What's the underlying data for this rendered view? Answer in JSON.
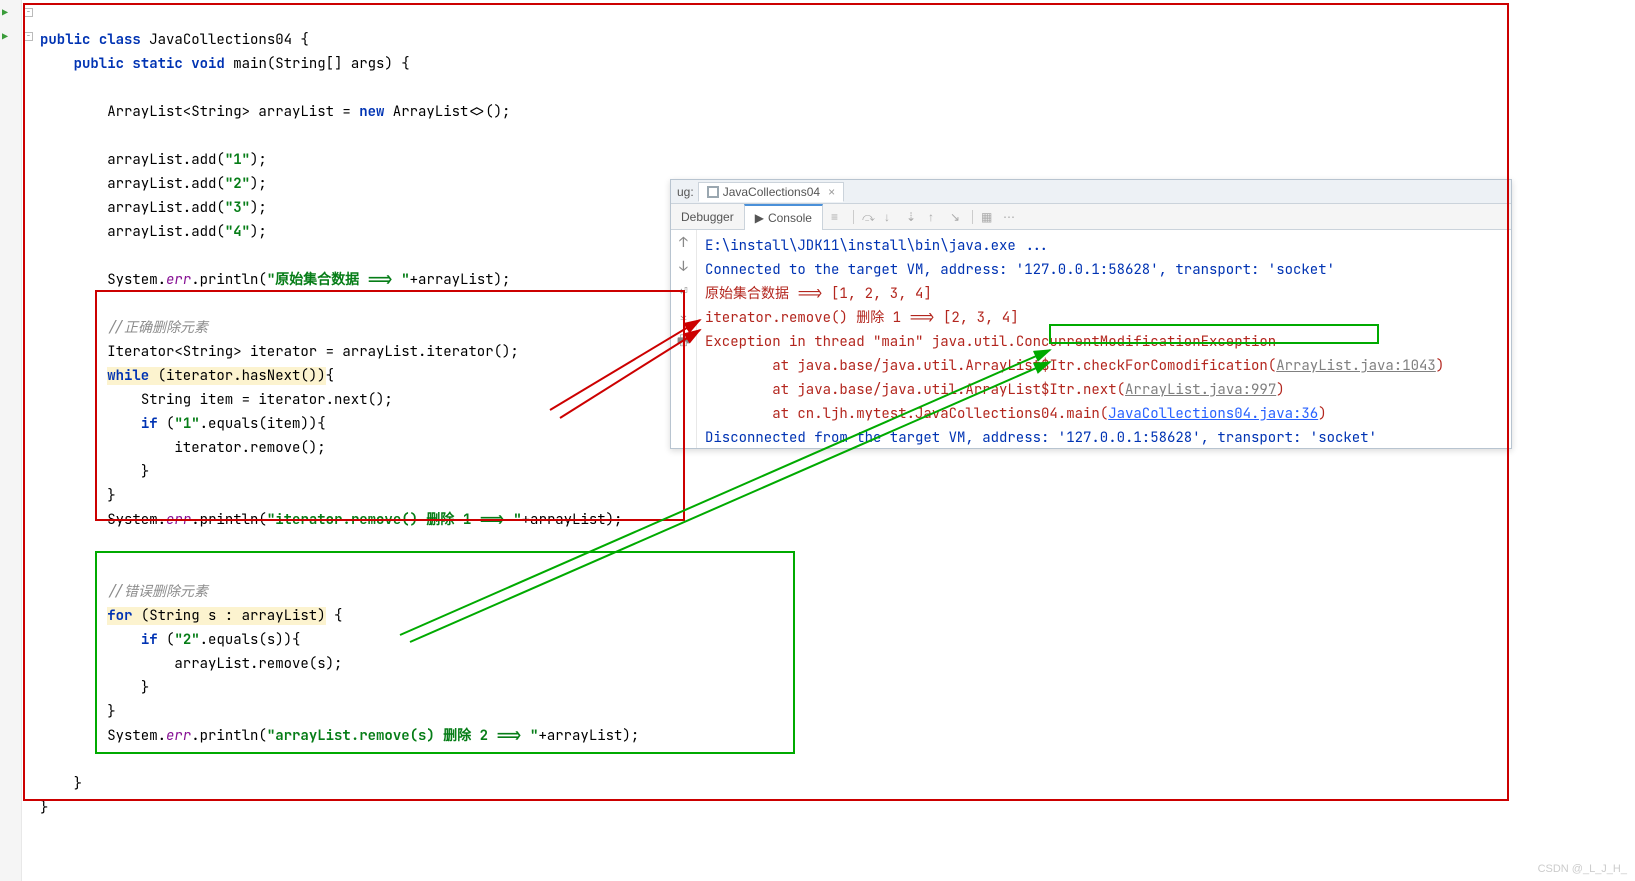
{
  "code": {
    "l1a": "public",
    "l1b": "class",
    "l1c": "JavaCollections04 {",
    "l2a": "public",
    "l2b": "static",
    "l2c": "void",
    "l2d": "main(String[] args) {",
    "l3a": "ArrayList<String> arrayList = ",
    "l3b": "new",
    "l3c": " ArrayList<>();",
    "l4": "arrayList.add(",
    "l4s": "\"1\"",
    "l4e": ");",
    "l5": "arrayList.add(",
    "l5s": "\"2\"",
    "l5e": ");",
    "l6": "arrayList.add(",
    "l6s": "\"3\"",
    "l6e": ");",
    "l7": "arrayList.add(",
    "l7s": "\"4\"",
    "l7e": ");",
    "l8a": "System.",
    "l8b": "err",
    "l8c": ".println(",
    "l8s": "\"原始集合数据 ==> \"",
    "l8d": "+arrayList);",
    "c1": "//正确删除元素",
    "l9": "Iterator<String> iterator = arrayList.iterator();",
    "l10a": "while",
    "l10b": " (iterator.hasNext())",
    "l10c": "{",
    "l11": "String item = iterator.next();",
    "l12a": "if",
    "l12b": " (",
    "l12s": "\"1\"",
    "l12c": ".equals(item)){",
    "l13": "iterator.remove();",
    "l14": "}",
    "l15": "}",
    "l16a": "System.",
    "l16b": "err",
    "l16c": ".println(",
    "l16s": "\"iterator.remove() 删除 1 ==> \"",
    "l16d": "+arrayList);",
    "c2": "//错误删除元素",
    "l17a": "for",
    "l17b": " (String s : arrayList)",
    "l17c": " {",
    "l18a": "if",
    "l18b": " (",
    "l18s": "\"2\"",
    "l18c": ".equals(s)){",
    "l19": "arrayList.remove(s);",
    "l20": "}",
    "l21": "}",
    "l22a": "System.",
    "l22b": "err",
    "l22c": ".println(",
    "l22s": "\"arrayList.remove(s) 删除 2 ==> \"",
    "l22d": "+arrayList);",
    "l23": "}",
    "l24": "}"
  },
  "console": {
    "run_label": "ug:",
    "file_tab": "JavaCollections04",
    "tab_debugger": "Debugger",
    "tab_console": "Console",
    "out1": "E:\\install\\JDK11\\install\\bin\\java.exe ...",
    "out2": "Connected to the target VM, address: '127.0.0.1:58628', transport: 'socket'",
    "out3": "原始集合数据 ==> [1, 2, 3, 4]",
    "out4": "iterator.remove() 删除 1 ==> [2, 3, 4]",
    "out5a": "Exception in thread \"main\" java.util.",
    "out5b": "ConcurrentModificationException",
    "out6a": "\tat java.base/java.util.ArrayList$Itr.checkForComodification(",
    "out6b": "ArrayList.java:1043",
    "out6c": ")",
    "out7a": "\tat java.base/java.util.ArrayList$Itr.next(",
    "out7b": "ArrayList.java:997",
    "out7c": ")",
    "out8a": "\tat cn.ljh.mytest.JavaCollections04.main(",
    "out8b": "JavaCollections04.java:36",
    "out8c": ")",
    "out9": "Disconnected from the target VM, address: '127.0.0.1:58628', transport: 'socket'"
  },
  "watermark": "CSDN @_L_J_H_"
}
